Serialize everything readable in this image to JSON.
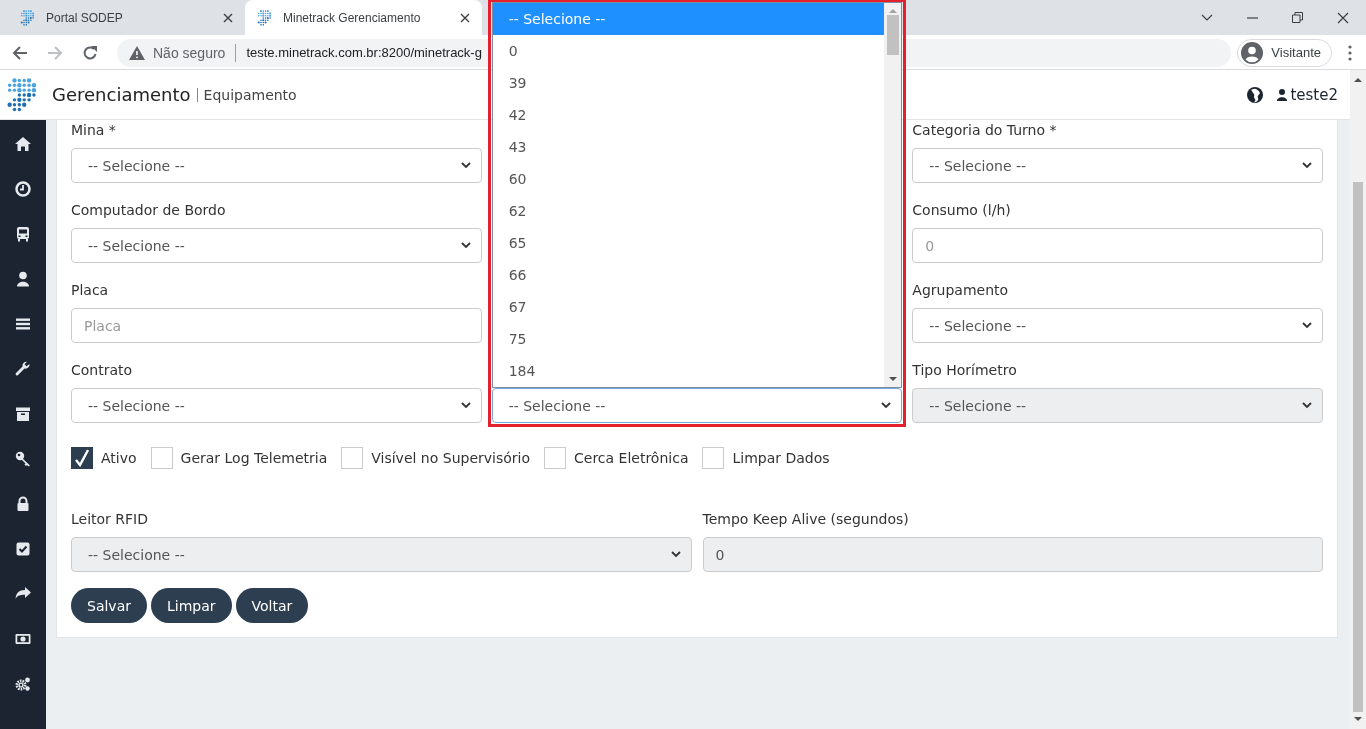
{
  "browser": {
    "tabs": [
      {
        "title": "Portal SODEP",
        "selected": false
      },
      {
        "title": "Minetrack Gerenciamento",
        "selected": true
      }
    ],
    "security": "Não seguro",
    "url": "teste.minetrack.com.br:8200/minetrack-g",
    "profile": "Visitante"
  },
  "app_header": {
    "title": "Gerenciamento",
    "subtitle": "Equipamento",
    "user": "teste2"
  },
  "form": {
    "columns": [
      [
        {
          "label": "Mina *",
          "kind": "select",
          "value": "-- Selecione --"
        },
        {
          "label": "Computador de Bordo",
          "kind": "select",
          "value": "-- Selecione --"
        },
        {
          "label": "Placa",
          "kind": "input",
          "placeholder": "Placa"
        },
        {
          "label": "Contrato",
          "kind": "select",
          "value": "-- Selecione --"
        }
      ],
      [
        {
          "kind": "select",
          "value": "-- Selecione --",
          "expanded": true,
          "highlighted": true,
          "options": [
            {
              "label": "-- Selecione --",
              "selected": true
            },
            {
              "label": "0",
              "selected": false
            },
            {
              "label": "39",
              "selected": false
            },
            {
              "label": "42",
              "selected": false
            },
            {
              "label": "43",
              "selected": false
            },
            {
              "label": "60",
              "selected": false
            },
            {
              "label": "62",
              "selected": false
            },
            {
              "label": "65",
              "selected": false
            },
            {
              "label": "66",
              "selected": false
            },
            {
              "label": "67",
              "selected": false
            },
            {
              "label": "75",
              "selected": false
            },
            {
              "label": "184",
              "selected": false
            }
          ]
        }
      ],
      [
        {
          "label": "Categoria do Turno *",
          "kind": "select",
          "value": "-- Selecione --"
        },
        {
          "label": "Consumo (l/h)",
          "kind": "input",
          "placeholder": "0"
        },
        {
          "label": "Agrupamento",
          "kind": "select",
          "value": "-- Selecione --"
        },
        {
          "label": "Tipo Horímetro",
          "kind": "select",
          "value": "-- Selecione --",
          "disabled": true
        }
      ]
    ],
    "checkboxes": [
      {
        "label": "Ativo",
        "checked": true
      },
      {
        "label": "Gerar Log Telemetria",
        "checked": false
      },
      {
        "label": "Visível no Supervisório",
        "checked": false
      },
      {
        "label": "Cerca Eletrônica",
        "checked": false
      },
      {
        "label": "Limpar Dados",
        "checked": false
      }
    ],
    "extra_fields": [
      {
        "label": "Leitor RFID",
        "kind": "select",
        "value": "-- Selecione --",
        "disabled": true
      },
      {
        "label": "Tempo Keep Alive (segundos)",
        "kind": "input",
        "value": "0",
        "disabled": true
      }
    ],
    "buttons": [
      "Salvar",
      "Limpar",
      "Voltar"
    ]
  }
}
